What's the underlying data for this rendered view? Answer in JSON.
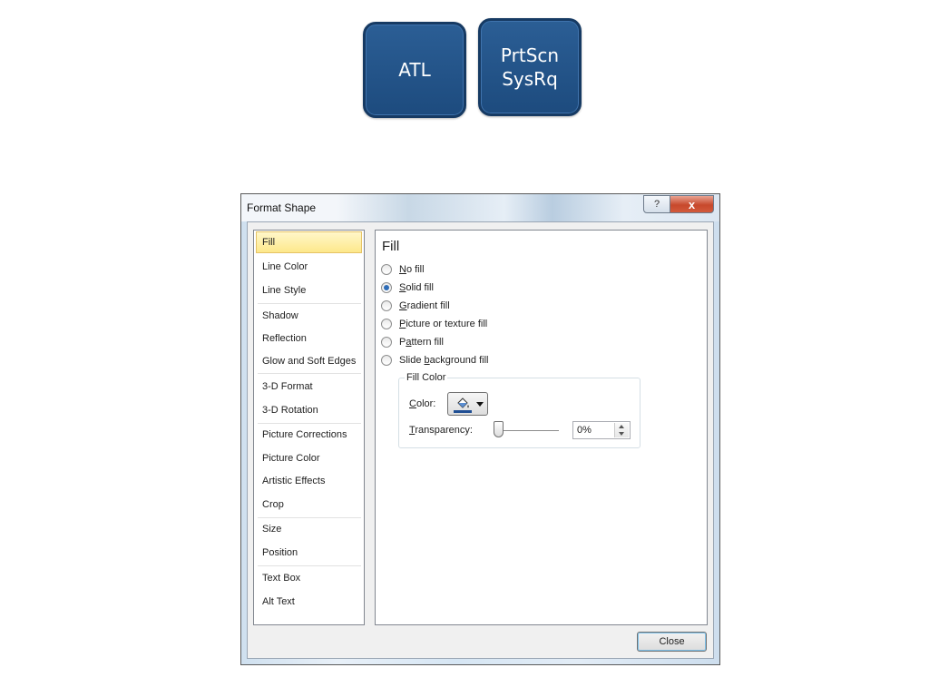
{
  "keys": [
    {
      "line1": "ATL",
      "line2": ""
    },
    {
      "line1": "PrtScn",
      "line2": "SysRq"
    }
  ],
  "dialog": {
    "title": "Format Shape",
    "help_button": "?",
    "close_x": "x",
    "nav_items": [
      "Fill",
      "Line Color",
      "Line Style",
      "Shadow",
      "Reflection",
      "Glow and Soft Edges",
      "3-D Format",
      "3-D Rotation",
      "Picture Corrections",
      "Picture Color",
      "Artistic Effects",
      "Crop",
      "Size",
      "Position",
      "Text Box",
      "Alt Text"
    ],
    "selected_nav": "Fill",
    "panel": {
      "title": "Fill",
      "options": [
        {
          "hot": "N",
          "rest": "o fill",
          "pre": "",
          "checked": false
        },
        {
          "hot": "S",
          "rest": "olid fill",
          "pre": "",
          "checked": true
        },
        {
          "hot": "G",
          "rest": "radient fill",
          "pre": "",
          "checked": false
        },
        {
          "hot": "P",
          "rest": "icture or texture fill",
          "pre": "",
          "checked": false
        },
        {
          "hot": "a",
          "rest": "ttern fill",
          "pre": "P",
          "checked": false
        },
        {
          "hot": "b",
          "rest": "ackground fill",
          "pre": "Slide ",
          "checked": false
        }
      ],
      "fill_color_group": "Fill Color",
      "color_label_hot": "C",
      "color_label_rest": "olor:",
      "color_icon": "paint-bucket-icon",
      "color_value": "#1f4e93",
      "transparency_label_hot": "T",
      "transparency_label_rest": "ransparency:",
      "transparency_value": "0%"
    },
    "close_button": "Close"
  }
}
